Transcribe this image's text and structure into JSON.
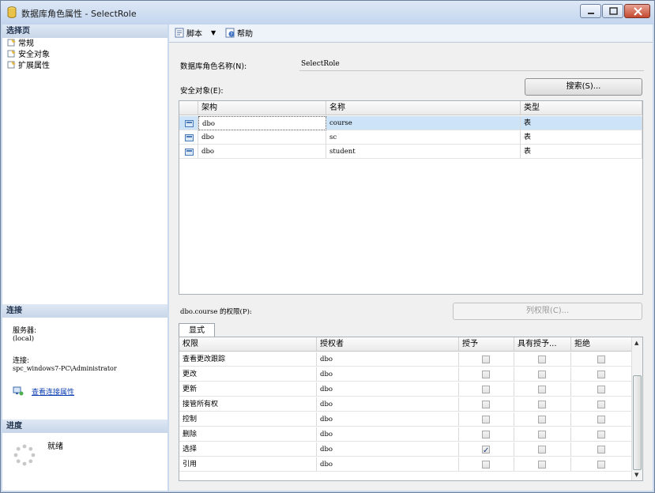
{
  "window": {
    "title": "数据库角色属性 - SelectRole",
    "buttons": [
      "minimize",
      "maximize",
      "close"
    ]
  },
  "left": {
    "select_page_header": "选择页",
    "nav": [
      {
        "label": "常规",
        "icon": "page-icon"
      },
      {
        "label": "安全对象",
        "icon": "page-icon"
      },
      {
        "label": "扩展属性",
        "icon": "page-icon"
      }
    ],
    "connection_header": "连接",
    "server_label": "服务器:",
    "server_value": "(local)",
    "connection_label": "连接:",
    "connection_value": "spc_windows7-PC\\Administrator",
    "view_connection_link": "查看连接属性",
    "progress_header": "进度",
    "progress_status": "就绪"
  },
  "toolbar": {
    "script_label": "脚本",
    "help_label": "帮助"
  },
  "main": {
    "role_name_label": "数据库角色名称(N):",
    "role_name_value": "SelectRole",
    "securables_label": "安全对象(E):",
    "search_button": "搜索(S)...",
    "securables_columns": [
      "架构",
      "名称",
      "类型"
    ],
    "securables_rows": [
      {
        "schema": "dbo",
        "name": "course",
        "type": "表",
        "selected": true
      },
      {
        "schema": "dbo",
        "name": "sc",
        "type": "表",
        "selected": false
      },
      {
        "schema": "dbo",
        "name": "student",
        "type": "表",
        "selected": false
      }
    ],
    "permissions_label": "dbo.course 的权限(P):",
    "column_permissions_button": "列权限(C)...",
    "tab_label": "显式",
    "permissions_columns": [
      "权限",
      "授权者",
      "授予",
      "具有授予...",
      "拒绝"
    ],
    "permissions_rows": [
      {
        "permission": "查看更改跟踪",
        "grantor": "dbo",
        "grant": false,
        "with_grant": false,
        "deny": false
      },
      {
        "permission": "更改",
        "grantor": "dbo",
        "grant": false,
        "with_grant": false,
        "deny": false
      },
      {
        "permission": "更新",
        "grantor": "dbo",
        "grant": false,
        "with_grant": false,
        "deny": false
      },
      {
        "permission": "接管所有权",
        "grantor": "dbo",
        "grant": false,
        "with_grant": false,
        "deny": false
      },
      {
        "permission": "控制",
        "grantor": "dbo",
        "grant": false,
        "with_grant": false,
        "deny": false
      },
      {
        "permission": "删除",
        "grantor": "dbo",
        "grant": false,
        "with_grant": false,
        "deny": false
      },
      {
        "permission": "选择",
        "grantor": "dbo",
        "grant": true,
        "with_grant": false,
        "deny": false
      },
      {
        "permission": "引用",
        "grantor": "dbo",
        "grant": false,
        "with_grant": false,
        "deny": false
      }
    ]
  }
}
